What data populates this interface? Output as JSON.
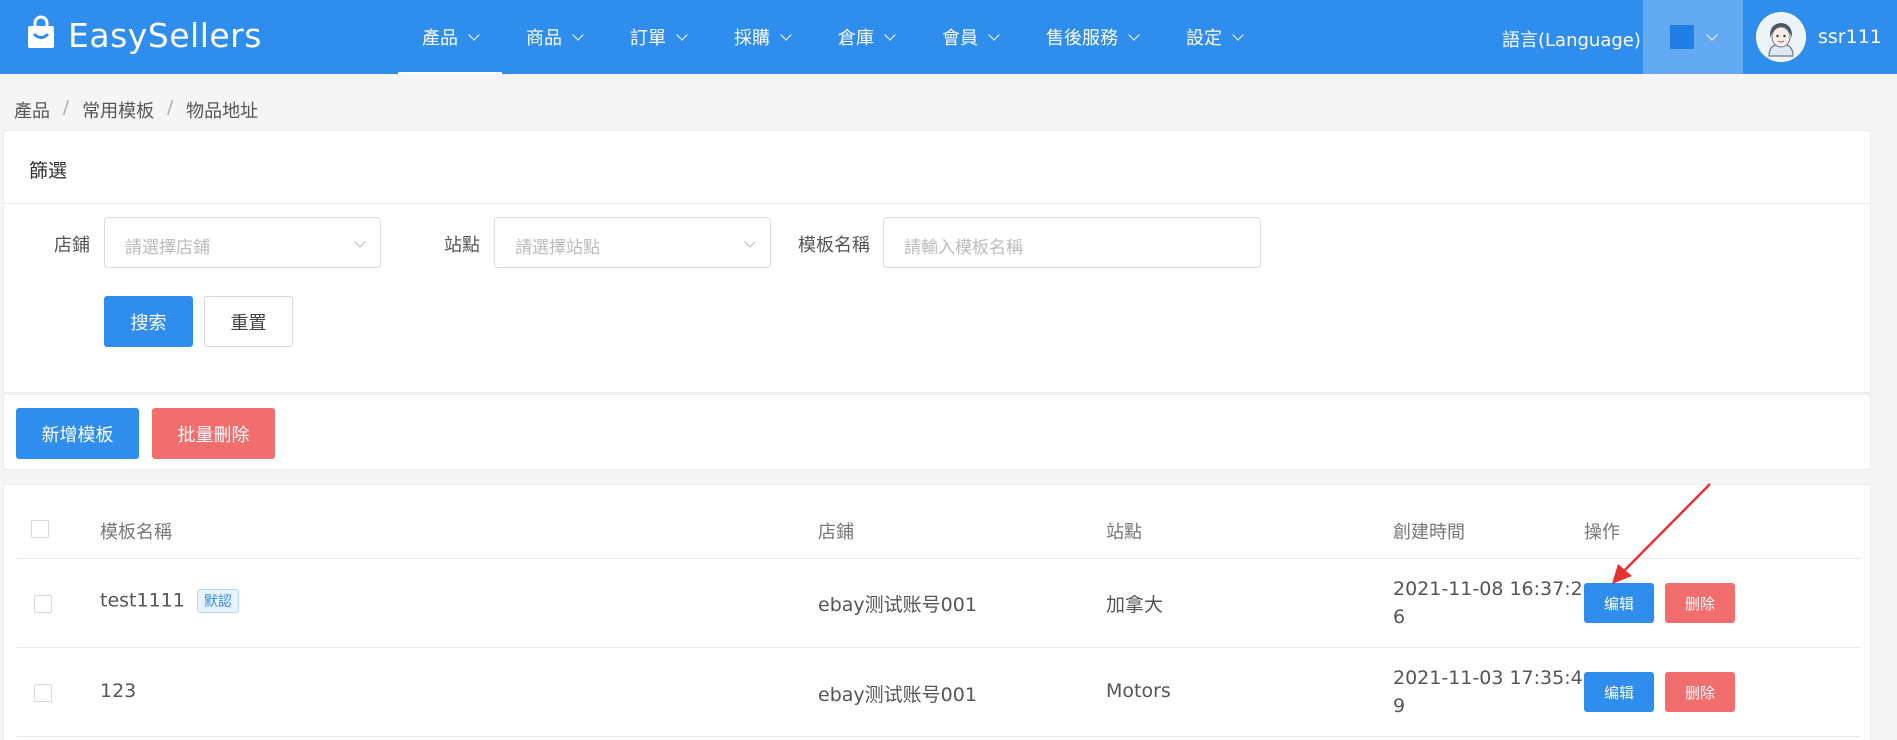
{
  "header": {
    "logo_text": "EasySellers",
    "nav": [
      {
        "label": "產品",
        "active": true
      },
      {
        "label": "商品"
      },
      {
        "label": "訂單"
      },
      {
        "label": "採購"
      },
      {
        "label": "倉庫"
      },
      {
        "label": "會員"
      },
      {
        "label": "售後服務"
      },
      {
        "label": "設定"
      }
    ],
    "language_label": "語言(Language)",
    "username": "ssr111",
    "brand_color": "#2f8ded"
  },
  "breadcrumb": [
    "產品",
    "常用模板",
    "物品地址"
  ],
  "filter": {
    "title": "篩選",
    "store_label": "店鋪",
    "store_placeholder": "請選擇店鋪",
    "site_label": "站點",
    "site_placeholder": "請選擇站點",
    "template_label": "模板名稱",
    "template_placeholder": "請輸入模板名稱",
    "search_button": "搜索",
    "reset_button": "重置"
  },
  "actions": {
    "add_button": "新增模板",
    "batch_delete_button": "批量刪除"
  },
  "table": {
    "headers": {
      "name": "模板名稱",
      "store": "店鋪",
      "site": "站點",
      "created": "創建時間",
      "ops": "操作"
    },
    "rows": [
      {
        "name": "test1111",
        "tag": "默認",
        "store": "ebay测试账号001",
        "site": "加拿大",
        "created_1": "2021-11-08 16:37:2",
        "created_2": "6",
        "edit": "编辑",
        "delete": "删除"
      },
      {
        "name": "123",
        "tag": "",
        "store": "ebay测试账号001",
        "site": "Motors",
        "created_1": "2021-11-03 17:35:4",
        "created_2": "9",
        "edit": "编辑",
        "delete": "删除"
      }
    ]
  }
}
